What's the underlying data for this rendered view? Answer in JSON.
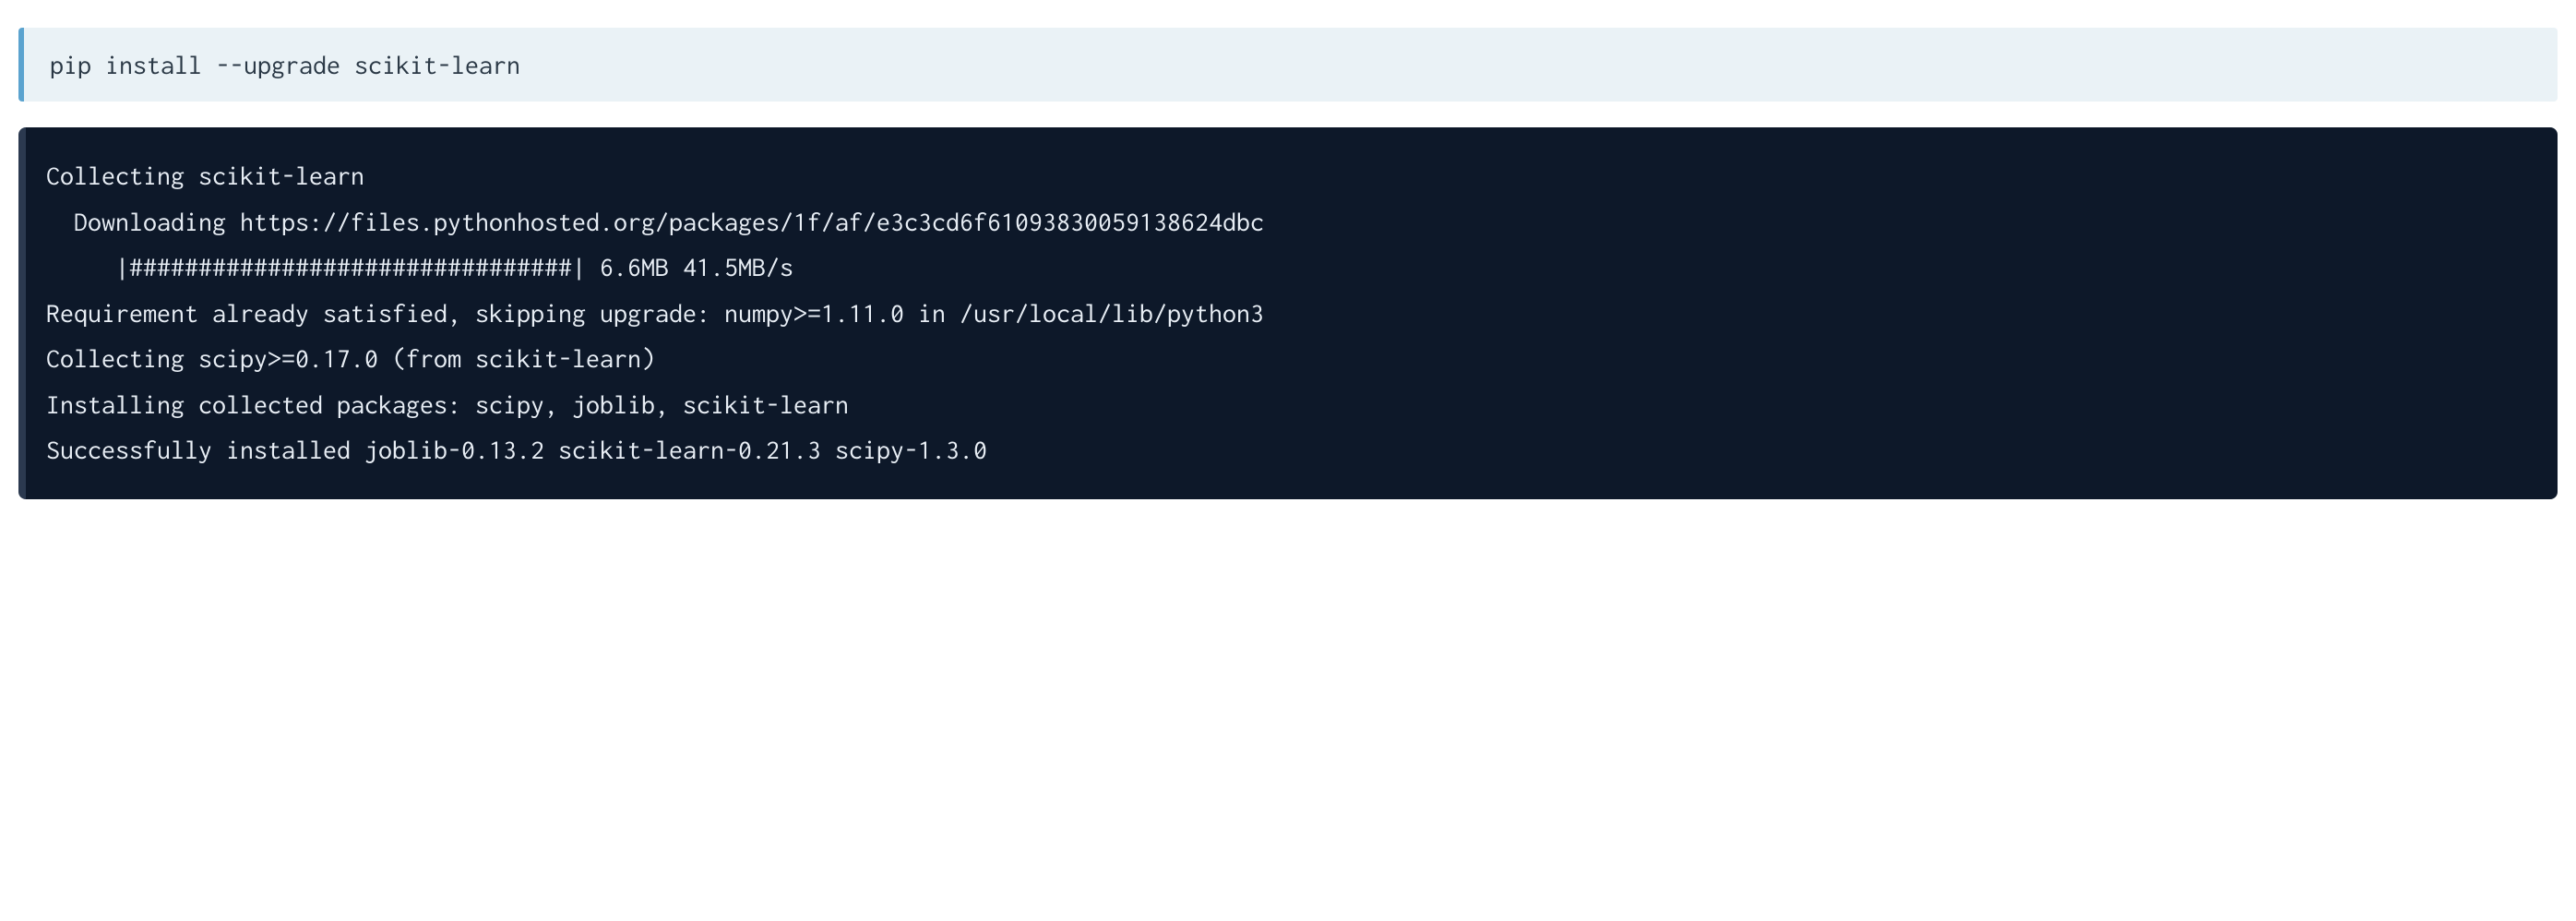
{
  "command": {
    "text": "pip install --upgrade scikit-learn"
  },
  "output": {
    "lines": [
      "Collecting scikit-learn",
      "  Downloading https://files.pythonhosted.org/packages/1f/af/e3c3cd6f61093830059138624dbc",
      "     |################################| 6.6MB 41.5MB/s ",
      "Requirement already satisfied, skipping upgrade: numpy>=1.11.0 in /usr/local/lib/python3",
      "Collecting scipy>=0.17.0 (from scikit-learn)",
      "Installing collected packages: scipy, joblib, scikit-learn",
      "Successfully installed joblib-0.13.2 scikit-learn-0.21.3 scipy-1.3.0"
    ]
  }
}
